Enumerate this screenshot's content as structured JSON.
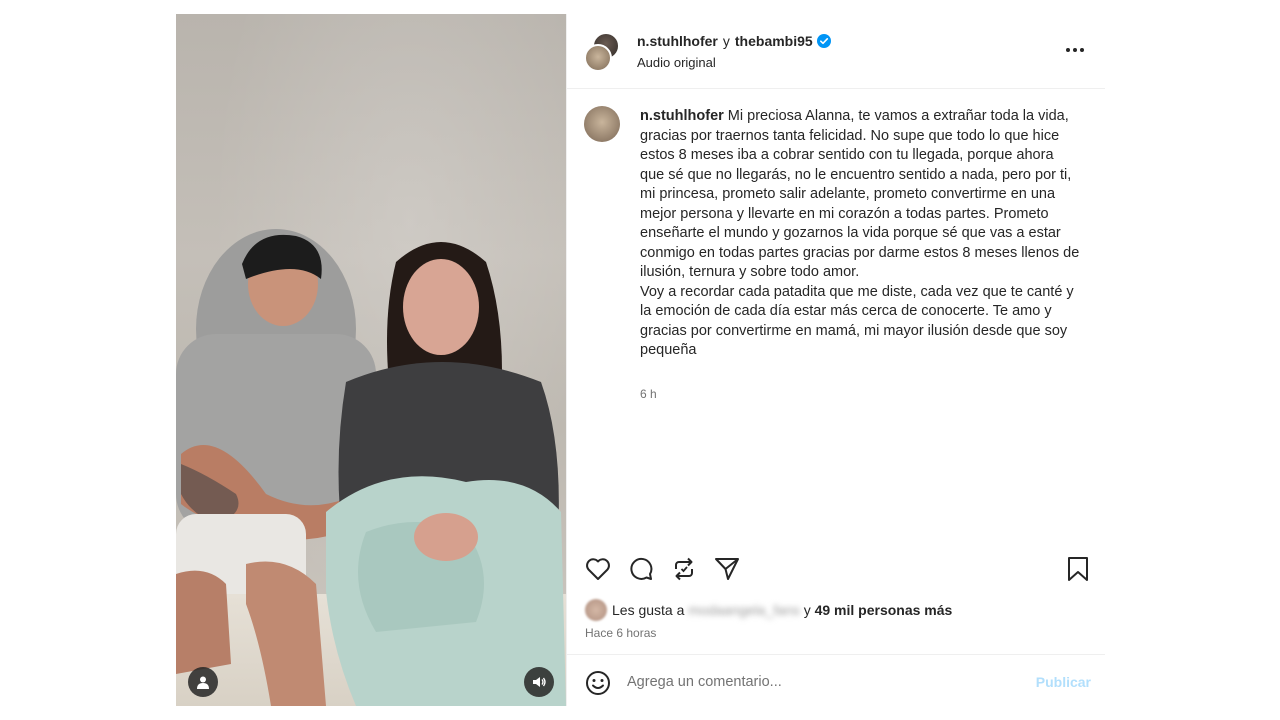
{
  "header": {
    "user1": "n.stuhlhofer",
    "separator": "y",
    "user2": "thebambi95",
    "audio": "Audio original",
    "verified_color": "#0095f6"
  },
  "caption": {
    "username": "n.stuhlhofer",
    "text": " Mi preciosa Alanna, te vamos a extrañar toda la vida, gracias por traernos tanta felicidad. No supe que todo lo que hice estos 8 meses iba a cobrar sentido con tu llegada, porque ahora que sé que no llegarás, no le encuentro sentido a nada, pero por ti, mi princesa, prometo salir adelante, prometo convertirme en una mejor persona y llevarte en mi corazón a todas partes. Prometo enseñarte el mundo y gozarnos la vida porque sé que vas a estar conmigo en todas partes gracias por darme estos 8 meses llenos de ilusión, ternura y sobre todo amor.\nVoy a recordar cada patadita que me diste, cada vez que te canté y la emoción de cada día estar más cerca de conocerte. Te amo y gracias por convertirme en mamá, mi mayor ilusión desde que soy pequeña",
    "time": "6 h"
  },
  "likes": {
    "prefix": "Les gusta a",
    "blurred_user": "modaangela_fans",
    "connector": "y",
    "count_text": "49 mil personas más"
  },
  "posted": "Hace 6 horas",
  "comment": {
    "placeholder": "Agrega un comentario...",
    "publish_label": "Publicar",
    "publish_color": "#b2dffc"
  },
  "icons": [
    "heart-icon",
    "comment-icon",
    "repost-icon",
    "share-icon",
    "bookmark-icon",
    "emoji-icon",
    "user-tag-icon",
    "speaker-icon",
    "more-options-icon",
    "verified-icon"
  ]
}
